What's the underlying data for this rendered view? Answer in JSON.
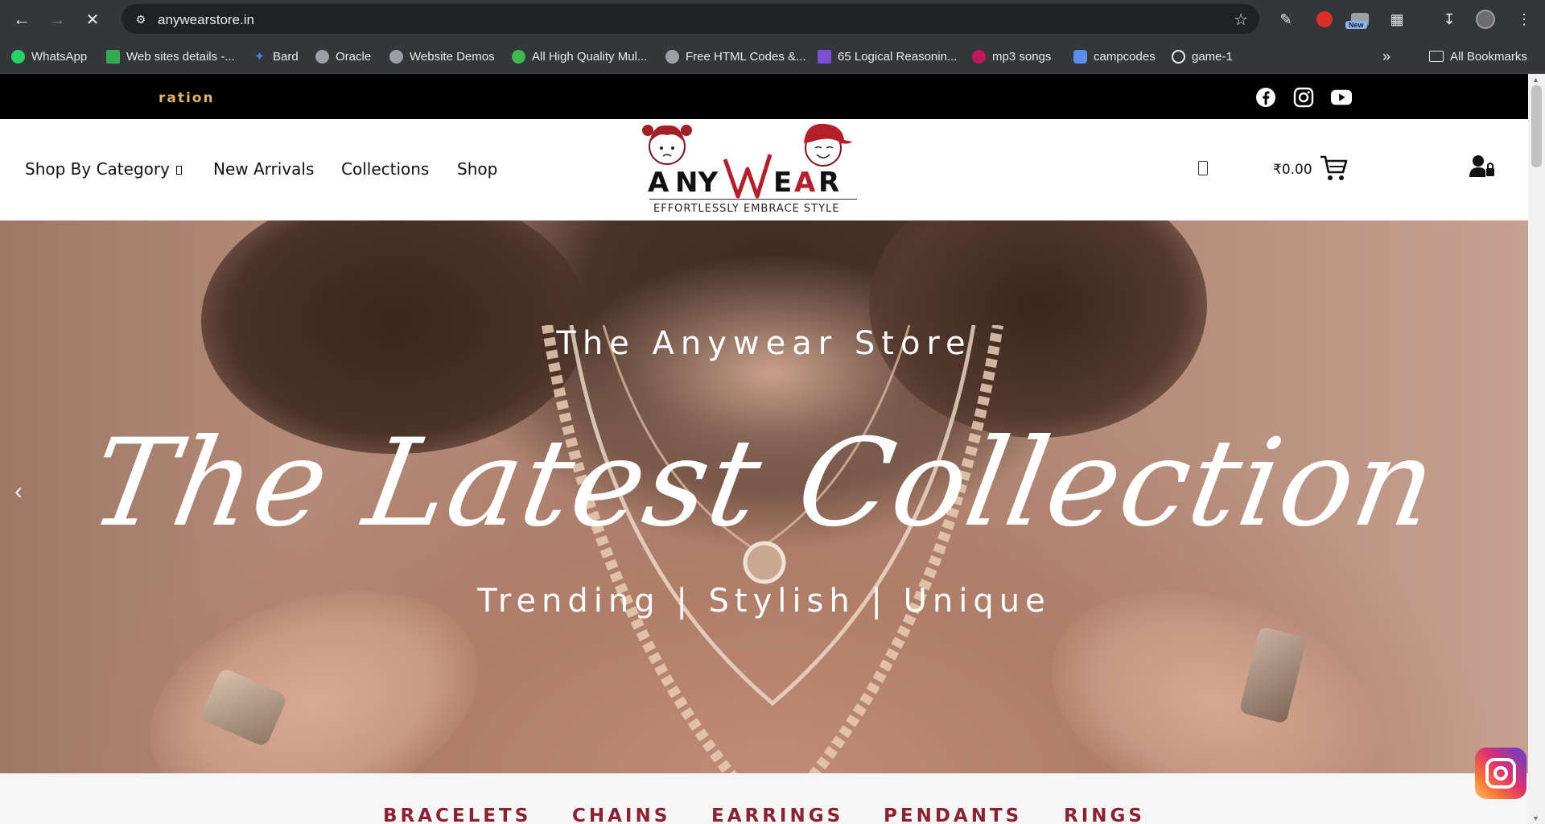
{
  "browser": {
    "url": "anywearstore.in",
    "new_badge": "New",
    "bookmarks": [
      {
        "label": "WhatsApp",
        "color": "#25d366"
      },
      {
        "label": "Web sites details -...",
        "color": "#34a853"
      },
      {
        "label": "Bard",
        "color": "#4285f4"
      },
      {
        "label": "Oracle",
        "color": "#9aa0a6"
      },
      {
        "label": "Website Demos",
        "color": "#9aa0a6"
      },
      {
        "label": "All High Quality Mul...",
        "color": "#3fb950"
      },
      {
        "label": "Free HTML Codes &...",
        "color": "#9aa0a6"
      },
      {
        "label": "65 Logical Reasonin...",
        "color": "#7b4fd6"
      },
      {
        "label": "mp3 songs",
        "color": "#c2185b"
      },
      {
        "label": "campcodes",
        "color": "#5b8def"
      },
      {
        "label": "game-1",
        "color": "#e8eaed"
      }
    ],
    "all_bookmarks": "All Bookmarks"
  },
  "topbar": {
    "marquee_text": "ration"
  },
  "header": {
    "menu": {
      "shop_by_category": "Shop By Category",
      "new_arrivals": "New Arrivals",
      "collections": "Collections",
      "shop": "Shop"
    },
    "logo": {
      "brand": "ANYWEAR",
      "tagline": "EFFORTLESSLY EMBRACE STYLE"
    },
    "cart_total": "₹0.00"
  },
  "hero": {
    "subtitle": "The Anywear Store",
    "script_title": "The Latest Collection",
    "tagline": "Trending | Stylish | Unique"
  },
  "categories": [
    "BRACELETS",
    "CHAINS",
    "EARRINGS",
    "PENDANTS",
    "RINGS"
  ],
  "colors": {
    "accent": "#8b2231",
    "marquee": "#e3b56a",
    "logo_red": "#b3202a"
  }
}
